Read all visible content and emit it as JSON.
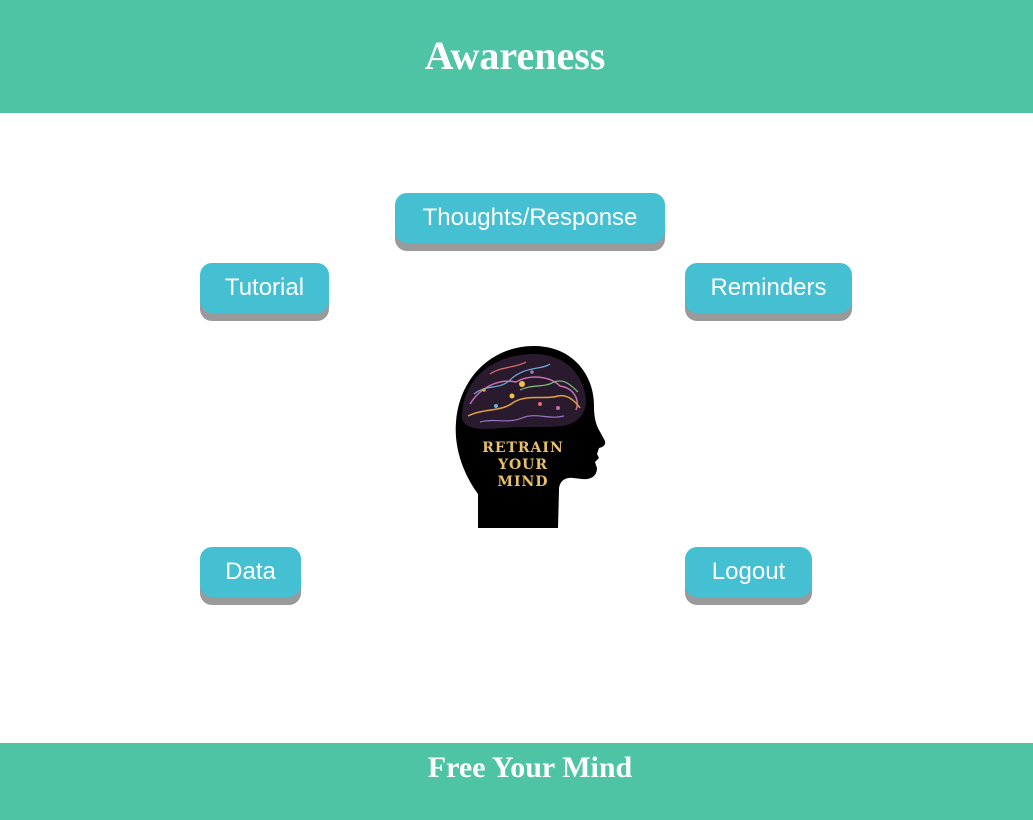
{
  "header": {
    "title": "Awareness"
  },
  "nav": {
    "thoughts_label": "Thoughts/Response",
    "tutorial_label": "Tutorial",
    "reminders_label": "Reminders",
    "data_label": "Data",
    "logout_label": "Logout"
  },
  "graphic": {
    "line1": "RETRAIN",
    "line2": "YOUR",
    "line3": "MIND"
  },
  "footer": {
    "title": "Free Your Mind"
  },
  "colors": {
    "banner": "#4fc4a4",
    "button": "#45bfd2",
    "button_shadow": "#9a9a9a",
    "text_on_color": "#ffffff",
    "brain_text": "#e8c06a"
  }
}
